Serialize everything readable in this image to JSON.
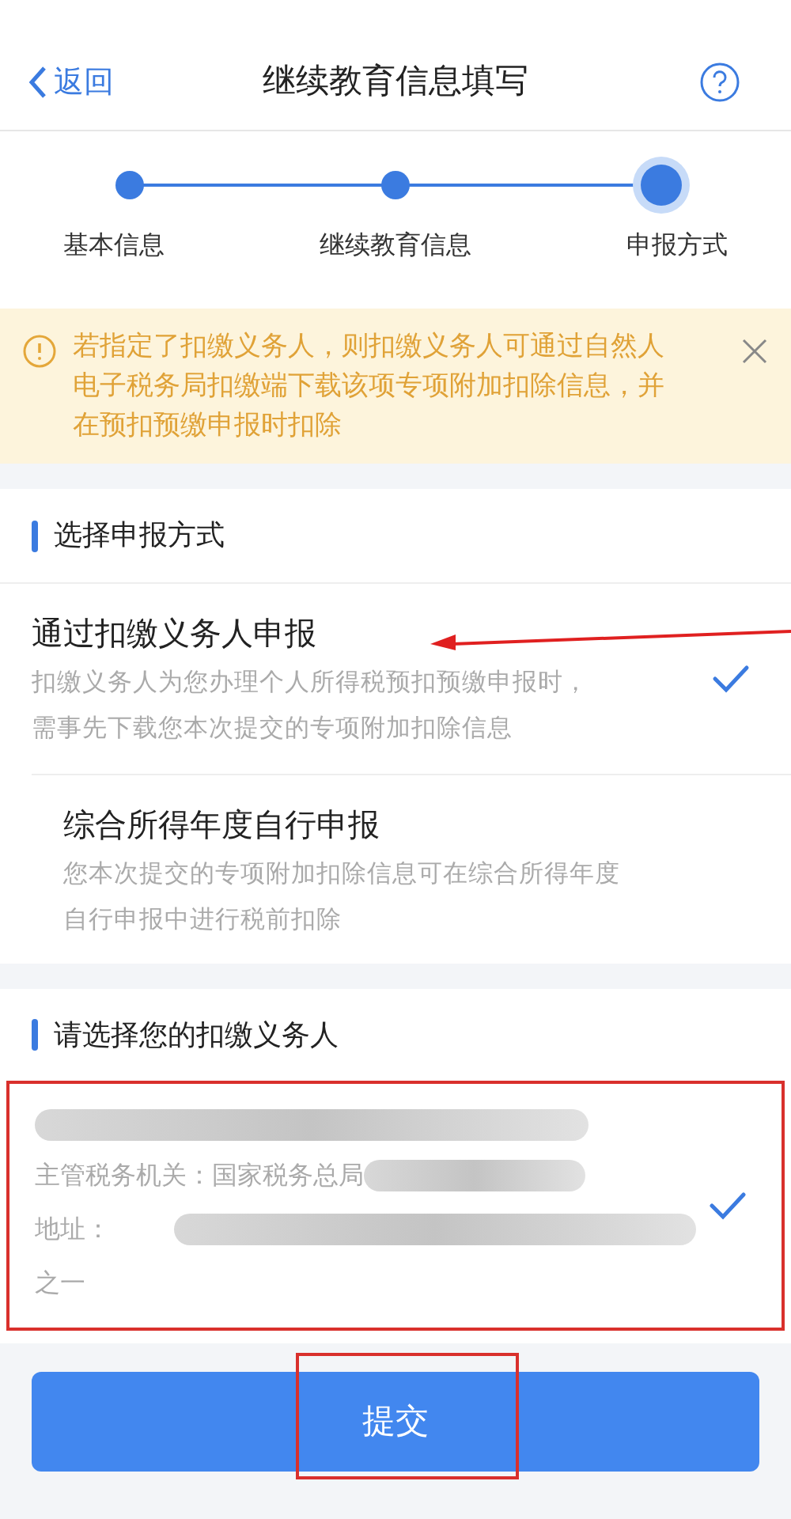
{
  "header": {
    "back": "返回",
    "title": "继续教育信息填写"
  },
  "steps": [
    {
      "label": "基本信息",
      "current": false
    },
    {
      "label": "继续教育信息",
      "current": false
    },
    {
      "label": "申报方式",
      "current": true
    }
  ],
  "notice": {
    "text": "若指定了扣缴义务人，则扣缴义务人可通过自然人电子税务局扣缴端下载该项专项附加扣除信息，并在预扣预缴申报时扣除"
  },
  "method_section": {
    "title": "选择申报方式",
    "options": [
      {
        "title": "通过扣缴义务人申报",
        "description_lines": [
          "扣缴义务人为您办理个人所得税预扣预缴申报时，",
          "需事先下载您本次提交的专项附加扣除信息"
        ],
        "selected": true,
        "annotated": true
      },
      {
        "title": "综合所得年度自行申报",
        "description_lines": [
          "您本次提交的专项附加扣除信息可在综合所得年度",
          "自行申报中进行税前扣除"
        ],
        "selected": false,
        "annotated": false
      }
    ]
  },
  "employer_section": {
    "title": "请选择您的扣缴义务人",
    "employers": [
      {
        "authority_label": "主管税务机关：",
        "authority": "国家税务总局",
        "address_label": "地址：",
        "address_tail": "之一",
        "selected": true,
        "annotated": true
      }
    ]
  },
  "submit": {
    "label": "提交",
    "annotated": true
  }
}
